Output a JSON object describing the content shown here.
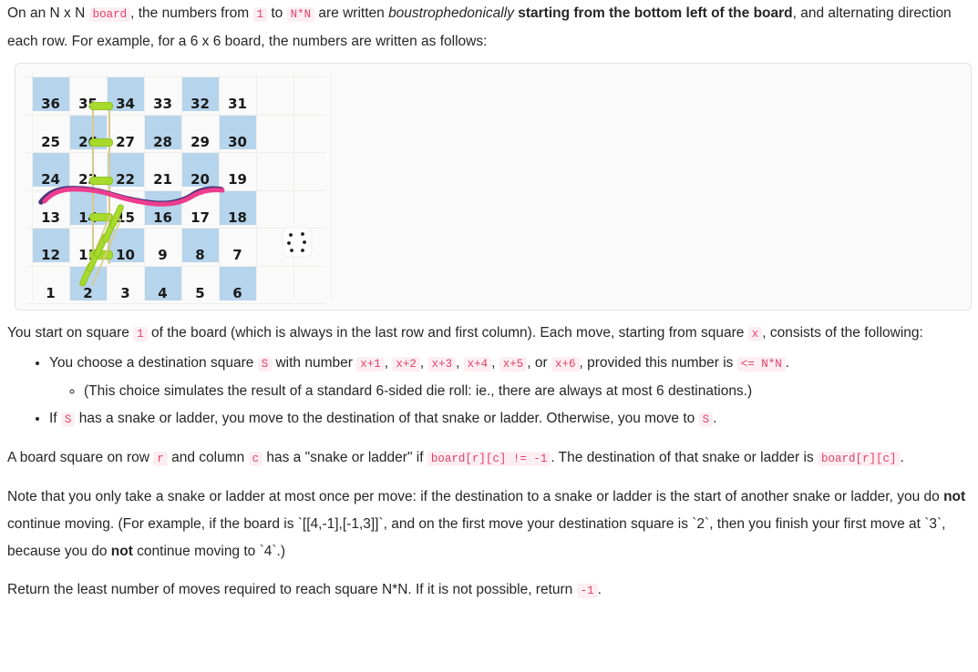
{
  "intro": {
    "part1": "On an N x N ",
    "code_board": "board",
    "part2": ", the numbers from ",
    "code_one": "1",
    "part3": " to ",
    "code_nn": "N*N",
    "part4": " are written ",
    "italic": "boustrophedonically",
    "part5": " ",
    "bold": "starting from the bottom left of the board",
    "part6": ", and alternating direction each row.  For example, for a 6 x 6 board, the numbers are written as follows:"
  },
  "board_figure": {
    "caption_alt": "6 x 6 boustrophedon numbered board with two ladders and one snake",
    "rows": [
      {
        "numbers": [
          "36",
          "35",
          "34",
          "33",
          "32",
          "31"
        ],
        "shaded": [
          true,
          false,
          true,
          false,
          true,
          false
        ]
      },
      {
        "numbers": [
          "25",
          "26",
          "27",
          "28",
          "29",
          "30"
        ],
        "shaded": [
          false,
          true,
          false,
          true,
          false,
          true
        ]
      },
      {
        "numbers": [
          "24",
          "23",
          "22",
          "21",
          "20",
          "19"
        ],
        "shaded": [
          true,
          false,
          true,
          false,
          true,
          false
        ]
      },
      {
        "numbers": [
          "13",
          "14",
          "15",
          "16",
          "17",
          "18"
        ],
        "shaded": [
          false,
          true,
          false,
          true,
          false,
          true
        ]
      },
      {
        "numbers": [
          "12",
          "11",
          "10",
          "9",
          "8",
          "7"
        ],
        "shaded": [
          true,
          false,
          true,
          false,
          true,
          false
        ]
      },
      {
        "numbers": [
          "1",
          "2",
          "3",
          "4",
          "5",
          "6"
        ],
        "shaded": [
          false,
          true,
          false,
          true,
          false,
          true
        ]
      }
    ],
    "colors": {
      "shaded_cell": "#b6d4ec",
      "plain_cell": "#ffffff",
      "ladder_rung": "#a8da2d",
      "ladder_rail": "#d9c98a",
      "snake": "#ee3d8f",
      "panel_bg": "#fafafa",
      "panel_border": "#e3e3e3"
    },
    "ladders": [
      {
        "name": "vertical-ladder",
        "from": "14",
        "to": "35"
      },
      {
        "name": "diagonal-ladder",
        "from": "2",
        "to": "15"
      }
    ],
    "snake": {
      "name": "snake",
      "from": "17",
      "to": "13"
    },
    "die": {
      "name": "die-icon",
      "pips": 6
    }
  },
  "start": {
    "part1": "You start on square ",
    "code_one": "1",
    "part2": " of the board (which is always in the last row and first column).  Each move, starting from square ",
    "code_x": "x",
    "part3": ", consists of the following:"
  },
  "bullets": {
    "choose": {
      "part1": "You choose a destination square ",
      "code_s": "S",
      "part2": " with number ",
      "codes": [
        "x+1",
        "x+2",
        "x+3",
        "x+4",
        "x+5",
        "x+6"
      ],
      "sep": ", ",
      "or_word": "or ",
      "part3": ", provided this number is ",
      "code_le": "<= N*N",
      "part4": "."
    },
    "sub": "(This choice simulates the result of a standard 6-sided die roll: ie., there are always at most 6 destinations.)",
    "snake_rule": {
      "part1": "If ",
      "code_s": "S",
      "part2": " has a snake or ladder, you move to the destination of that snake or ladder.  Otherwise, you move to ",
      "code_s2": "S",
      "part3": "."
    }
  },
  "definition": {
    "part1": "A board square on row ",
    "code_r": "r",
    "part2": " and column ",
    "code_c": "c",
    "part3": " has a \"snake or ladder\" if ",
    "code_cond": "board[r][c] != -1",
    "part4": ".  The destination of that snake or ladder is ",
    "code_dest": "board[r][c]",
    "part5": "."
  },
  "note": {
    "part1": "Note that you only take a snake or ladder at most once per move: if the destination to a snake or ladder is the start of another snake or ladder, you do ",
    "bold1": "not",
    "part2": " continue moving.  (For example, if the board is `[[4,-1],[-1,3]]`, and on the first move your destination square is `2`, then you finish your first move at `3`, because you do ",
    "bold2": "not",
    "part3": " continue moving to `4`.)"
  },
  "returns": {
    "part1": "Return the least number of moves required to reach square N*N.  If it is not possible, return ",
    "code_neg": "-1",
    "part2": "."
  }
}
